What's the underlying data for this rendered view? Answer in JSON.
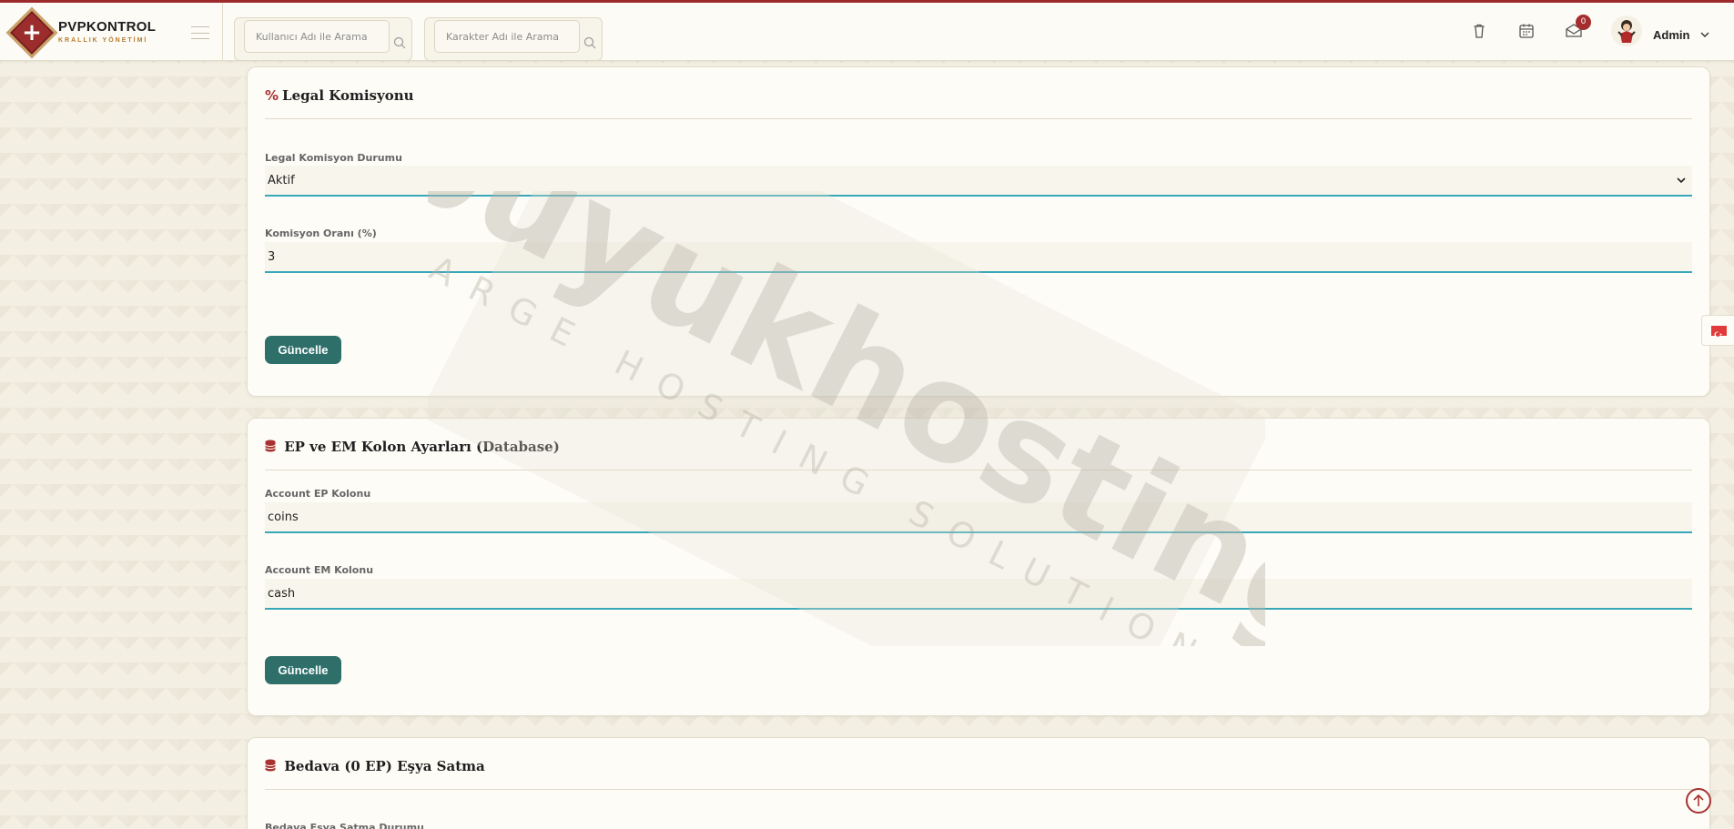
{
  "app": {
    "brand_title": "PVPKONTROL",
    "brand_subtitle": "KRALLIK YÖNETİMİ",
    "accent_color": "#9e2b2b",
    "button_color": "#2f6f6a",
    "field_underline_color": "#38a8b8"
  },
  "header": {
    "search_user_placeholder": "Kullanıcı Adı ile Arama",
    "search_character_placeholder": "Karakter Adı ile Arama",
    "icons": [
      "trash-icon",
      "calendar-icon",
      "mail-icon"
    ],
    "mail_badge": "0",
    "user_name": "Admin"
  },
  "cards": {
    "legal": {
      "icon": "%",
      "title": "Legal Komisyonu",
      "status_label": "Legal Komisyon Durumu",
      "status_value": "Aktif",
      "rate_label": "Komisyon Oranı (%)",
      "rate_value": "3",
      "submit_label": "Güncelle"
    },
    "ep_em": {
      "icon": "database-icon",
      "title": "EP ve EM Kolon Ayarları (Database)",
      "ep_label": "Account EP Kolonu",
      "ep_value": "coins",
      "em_label": "Account EM Kolonu",
      "em_value": "cash",
      "submit_label": "Güncelle"
    },
    "free_item": {
      "icon": "database-icon",
      "title": "Bedava (0 EP) Eşya Satma",
      "status_label": "Bedava Eşya Satma Durumu"
    }
  },
  "watermark": {
    "brand": "buyukhosting",
    "tagline": "LARGE HOSTING SOLUTIONS"
  },
  "language_flag": "turkey-flag-icon"
}
